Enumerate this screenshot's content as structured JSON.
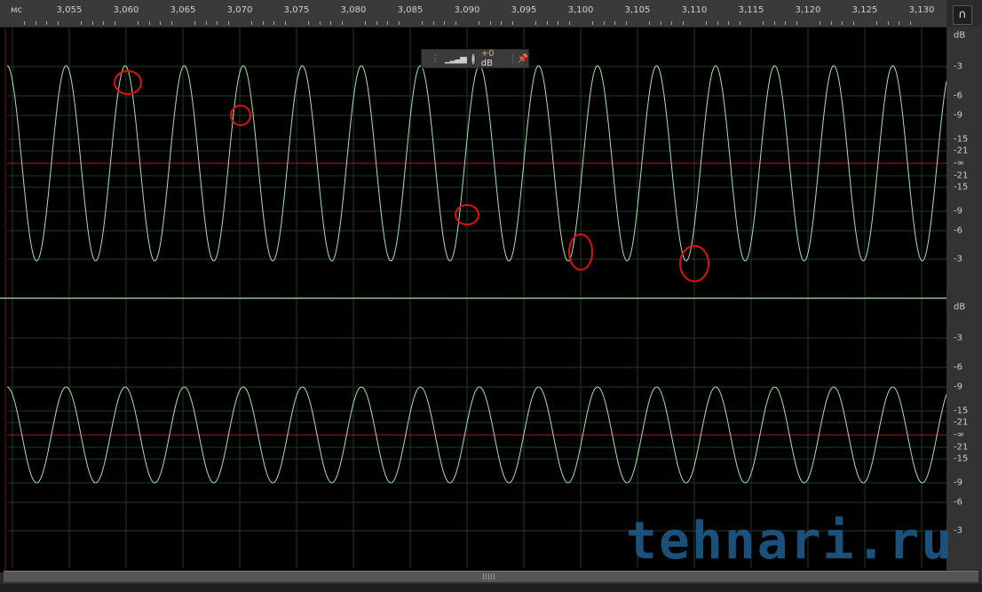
{
  "ruler": {
    "unit": "мс",
    "ticks": [
      "3,055",
      "3,060",
      "3,065",
      "3,070",
      "3,075",
      "3,080",
      "3,085",
      "3,090",
      "3,095",
      "3,100",
      "3,105",
      "3,110",
      "3,115",
      "3,120",
      "3,125",
      "3,130"
    ]
  },
  "snap_icon": "magnet-icon",
  "hud": {
    "gain": "+0",
    "unit": "dB",
    "icons": [
      "grip-icon",
      "level-meter-icon",
      "volume-knob-icon",
      "pin-icon"
    ]
  },
  "db_scale": {
    "channel1": [
      "dB",
      "-3",
      "-6",
      "-9",
      "-15",
      "-21",
      "-∞",
      "-21",
      "-15",
      "-9",
      "-6",
      "-3"
    ],
    "channel2": [
      "dB",
      "-3",
      "-6",
      "-9",
      "-15",
      "-21",
      "-∞",
      "-21",
      "-15",
      "-9",
      "-6",
      "-3"
    ]
  },
  "watermark": "tehnari.ru",
  "colors": {
    "wave": "#a8e0b0",
    "zero_line": "#9b1f2a",
    "grid": "#1f3a26",
    "highlight": "#e01010"
  }
}
